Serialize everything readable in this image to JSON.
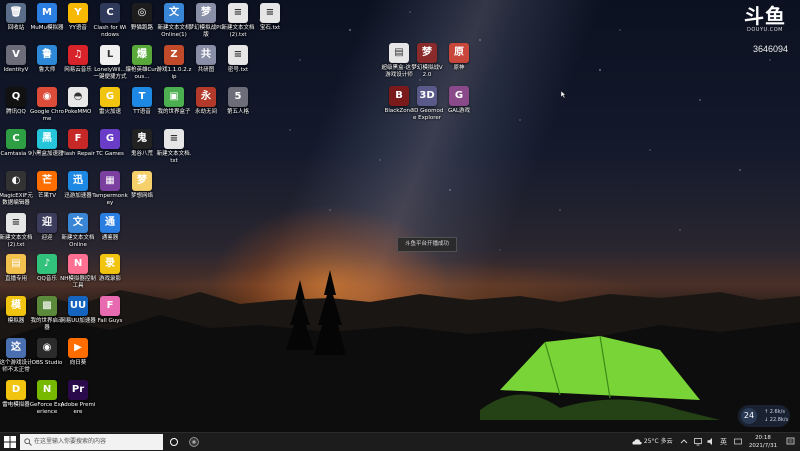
{
  "watermark": {
    "brand": "斗鱼",
    "domain": "DOUYU.COM",
    "room_id": "3646094"
  },
  "desktop_icons": [
    {
      "label": "回收站",
      "color": "#5a6e8a",
      "glyph": "🗑"
    },
    {
      "label": "MuMu模拟器",
      "color": "#2a7de1",
      "glyph": "M"
    },
    {
      "label": "YY语音",
      "color": "#f6b800",
      "glyph": "Y"
    },
    {
      "label": "Clash for Windows",
      "color": "#2f3a5a",
      "glyph": "C"
    },
    {
      "label": "野猫跑路",
      "color": "#1d1d1d",
      "glyph": "◎"
    },
    {
      "label": "新建文本文档Online(1)",
      "color": "#3a86d6",
      "glyph": "文"
    },
    {
      "label": "梦幻模拟战PC版",
      "color": "#8a8fa8",
      "glyph": "梦"
    },
    {
      "label": "新建文本文档(2).txt",
      "color": "#e6e6e6",
      "glyph": "≡"
    },
    {
      "label": "宝石.txt",
      "color": "#e6e6e6",
      "glyph": "≡"
    },
    {
      "label": "IdentityV",
      "color": "#6d6d7a",
      "glyph": "V"
    },
    {
      "label": "鲁大师",
      "color": "#2d88d8",
      "glyph": "鲁"
    },
    {
      "label": "网易云音乐",
      "color": "#d8232a",
      "glyph": "♫"
    },
    {
      "label": "LonelyWil...一键便捷方式",
      "color": "#f0f0f0",
      "glyph": "L"
    },
    {
      "label": "爆枪英雄Curious...",
      "color": "#58a83a",
      "glyph": "爆"
    },
    {
      "label": "游戏1.1.0.2.zip",
      "color": "#c04a2a",
      "glyph": "Z"
    },
    {
      "label": "共研图",
      "color": "#8a8fa8",
      "glyph": "共"
    },
    {
      "label": "密号.txt",
      "color": "#e6e6e6",
      "glyph": "≡"
    },
    {
      "label": "腾讯QQ",
      "color": "#111111",
      "glyph": "Q"
    },
    {
      "label": "Google Chrome",
      "color": "#dd4b39",
      "glyph": "◉"
    },
    {
      "label": "PokeMMO",
      "color": "#e8e8e8",
      "glyph": "◓"
    },
    {
      "label": "雷火加速",
      "color": "#f1c40f",
      "glyph": "G"
    },
    {
      "label": "TT语音",
      "color": "#1e88e5",
      "glyph": "T"
    },
    {
      "label": "我的世界盒子",
      "color": "#4caf50",
      "glyph": "▣"
    },
    {
      "label": "永劫无间",
      "color": "#b33a2a",
      "glyph": "永"
    },
    {
      "label": "第五人格",
      "color": "#6d6d7a",
      "glyph": "5"
    },
    {
      "label": "Camtasia 9",
      "color": "#2e9e44",
      "glyph": "C"
    },
    {
      "label": "小黑盒加速器",
      "color": "#26c6da",
      "glyph": "黑"
    },
    {
      "label": "Flash Repair",
      "color": "#c62828",
      "glyph": "F"
    },
    {
      "label": "TC Games",
      "color": "#6a3dc8",
      "glyph": "G"
    },
    {
      "label": "鬼谷八荒",
      "color": "#222222",
      "glyph": "鬼"
    },
    {
      "label": "新建文本文档.txt",
      "color": "#e6e6e6",
      "glyph": "≡"
    },
    {
      "label": "MagicEXIF元数据编辑器",
      "color": "#333333",
      "glyph": "◐"
    },
    {
      "label": "芒果TV",
      "color": "#ff6f00",
      "glyph": "芒"
    },
    {
      "label": "迅游加速器",
      "color": "#1e88e5",
      "glyph": "迅"
    },
    {
      "label": "Tampermonkey",
      "color": "#7b3fa0",
      "glyph": "▦"
    },
    {
      "label": "梦想网络",
      "color": "#f5d06b",
      "glyph": "梦"
    },
    {
      "label": "新建文本文档(2).txt",
      "color": "#e6e6e6",
      "glyph": "≡"
    },
    {
      "label": "迎迎",
      "color": "#3c3c5c",
      "glyph": "迎"
    },
    {
      "label": "新建文本文档Online",
      "color": "#3a86d6",
      "glyph": "文"
    },
    {
      "label": "通鉴器",
      "color": "#2a7de1",
      "glyph": "通"
    },
    {
      "label": "直播专用",
      "color": "#f2c14e",
      "glyph": "▤"
    },
    {
      "label": "QQ音乐",
      "color": "#31c27c",
      "glyph": "♪"
    },
    {
      "label": "NH模拟器控制工具",
      "color": "#ff6f91",
      "glyph": "N"
    },
    {
      "label": "游戏录影",
      "color": "#f1c40f",
      "glyph": "录"
    },
    {
      "label": "模拟器",
      "color": "#f1c40f",
      "glyph": "模"
    },
    {
      "label": "我的世界启动器",
      "color": "#5b8a3a",
      "glyph": "▩"
    },
    {
      "label": "网易UU加速器",
      "color": "#1565c0",
      "glyph": "UU"
    },
    {
      "label": "Fall Guys",
      "color": "#e86ab0",
      "glyph": "F"
    },
    {
      "label": "这个游戏设计师不太正常",
      "color": "#4a6fb0",
      "glyph": "这"
    },
    {
      "label": "OBS Studio",
      "color": "#2b2b2b",
      "glyph": "◉"
    },
    {
      "label": "向日葵",
      "color": "#ff6d00",
      "glyph": "▶"
    },
    {
      "label": "雷电模拟器",
      "color": "#f1c40f",
      "glyph": "D"
    },
    {
      "label": "GeForce Experience",
      "color": "#76b900",
      "glyph": "N"
    },
    {
      "label": "Adobe Premiere",
      "color": "#2a0a4a",
      "glyph": "Pr"
    },
    {
      "label": "超级黑盒-这个游戏设计师",
      "color": "#e6e6e6",
      "glyph": "▤"
    },
    {
      "label": "梦幻模拟战V2.0",
      "color": "#8a2a2a",
      "glyph": "梦"
    },
    {
      "label": "原神",
      "color": "#c8463a",
      "glyph": "原"
    },
    {
      "label": "BlackZone",
      "color": "#7a1a1a",
      "glyph": "B"
    },
    {
      "label": "3D Geomode Explorer",
      "color": "#5a5a8a",
      "glyph": "3D"
    },
    {
      "label": "GAL游戏",
      "color": "#8a4a8a",
      "glyph": "G"
    },
    {
      "label": "TouhouMaker",
      "color": "#c8c8c8",
      "glyph": "T"
    }
  ],
  "toast": "斗鱼平台开播成功",
  "weather_widget": {
    "temp": "24",
    "upload": "2.6k/s",
    "download": "22.8k/s"
  },
  "taskbar": {
    "search_placeholder": "在这里输入你要搜索的内容",
    "weather": "25°C 多云",
    "time": "20:18",
    "date": "2021/7/31"
  }
}
